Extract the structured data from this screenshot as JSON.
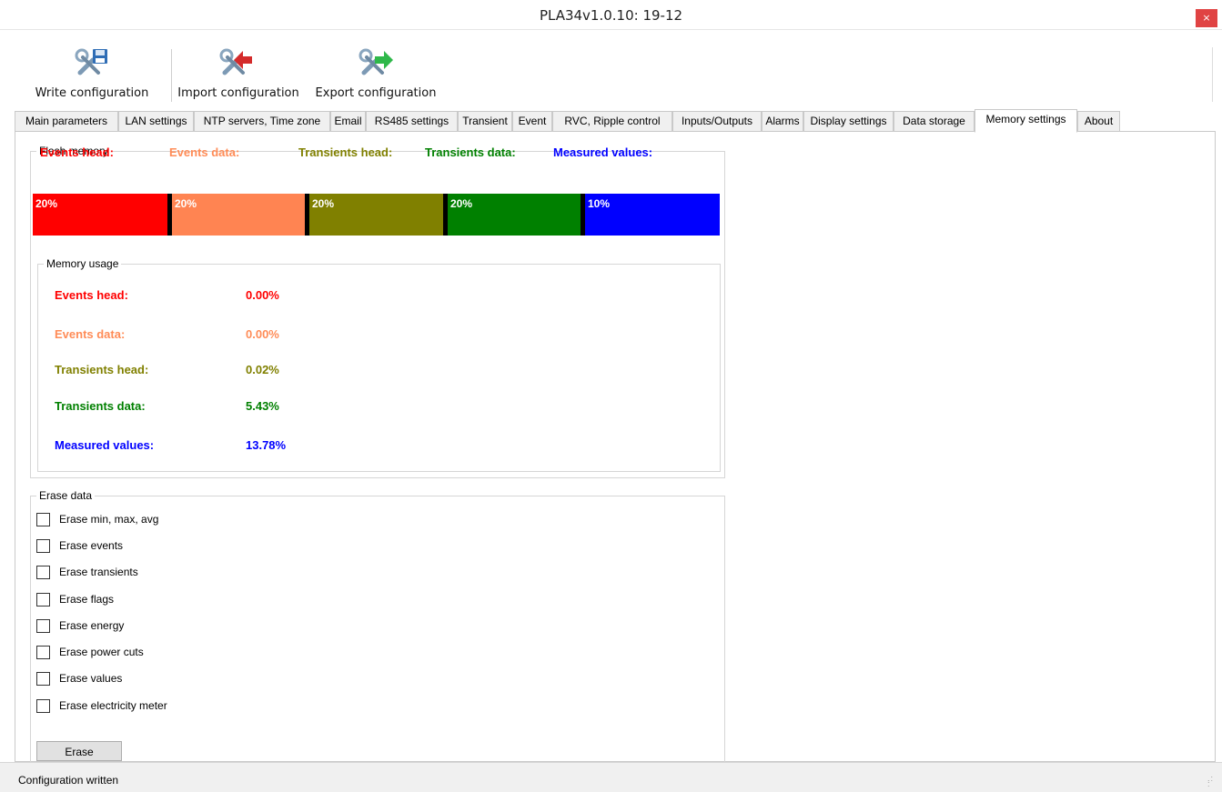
{
  "window": {
    "title": "PLA34v1.0.10: 19-12",
    "close_glyph": "×"
  },
  "toolbar": {
    "buttons": [
      {
        "label": "Write configuration",
        "icon": "tools-save-icon"
      },
      {
        "label": "Import configuration",
        "icon": "tools-import-icon"
      },
      {
        "label": "Export configuration",
        "icon": "tools-export-icon"
      }
    ]
  },
  "tabs": [
    {
      "label": "Main parameters"
    },
    {
      "label": "LAN settings"
    },
    {
      "label": "NTP servers, Time zone"
    },
    {
      "label": "Email"
    },
    {
      "label": "RS485 settings"
    },
    {
      "label": "Transient"
    },
    {
      "label": "Event"
    },
    {
      "label": "RVC, Ripple control"
    },
    {
      "label": "Inputs/Outputs"
    },
    {
      "label": "Alarms"
    },
    {
      "label": "Display settings"
    },
    {
      "label": "Data storage"
    },
    {
      "label": "Memory settings",
      "active": true
    },
    {
      "label": "About"
    }
  ],
  "flash_memory": {
    "title": "Flash memory",
    "segments": [
      {
        "label": "Events head:",
        "percent": "20%",
        "share": 0.2,
        "label_color": "#ff0000",
        "bar_color": "#ff0000"
      },
      {
        "label": "Events data:",
        "percent": "20%",
        "share": 0.2,
        "label_color": "#ff8c57",
        "bar_color": "#ff8452"
      },
      {
        "label": "Transients head:",
        "percent": "20%",
        "share": 0.2,
        "label_color": "#808000",
        "bar_color": "#808000"
      },
      {
        "label": "Transients data:",
        "percent": "20%",
        "share": 0.2,
        "label_color": "#008000",
        "bar_color": "#008000"
      },
      {
        "label": "Measured values:",
        "percent": "10%",
        "share": 0.1,
        "label_color": "#0000ff",
        "bar_color": "#0000ff"
      }
    ]
  },
  "memory_usage": {
    "title": "Memory usage",
    "rows": [
      {
        "label": "Events head:",
        "value": "0.00%",
        "color": "#ff0000"
      },
      {
        "label": "Events data:",
        "value": "0.00%",
        "color": "#ff8c57"
      },
      {
        "label": "Transients head:",
        "value": "0.02%",
        "color": "#808000"
      },
      {
        "label": "Transients data:",
        "value": "5.43%",
        "color": "#008000"
      },
      {
        "label": "Measured values:",
        "value": "13.78%",
        "color": "#0000ff"
      }
    ]
  },
  "erase_data": {
    "title": "Erase data",
    "options": [
      {
        "label": "Erase min, max, avg",
        "checked": false
      },
      {
        "label": "Erase events",
        "checked": false
      },
      {
        "label": "Erase transients",
        "checked": false
      },
      {
        "label": "Erase flags",
        "checked": false
      },
      {
        "label": "Erase energy",
        "checked": false
      },
      {
        "label": "Erase power cuts",
        "checked": false
      },
      {
        "label": "Erase values",
        "checked": false
      },
      {
        "label": "Erase electricity meter",
        "checked": false
      }
    ],
    "button_label": "Erase"
  },
  "status": {
    "text": "Configuration written"
  }
}
